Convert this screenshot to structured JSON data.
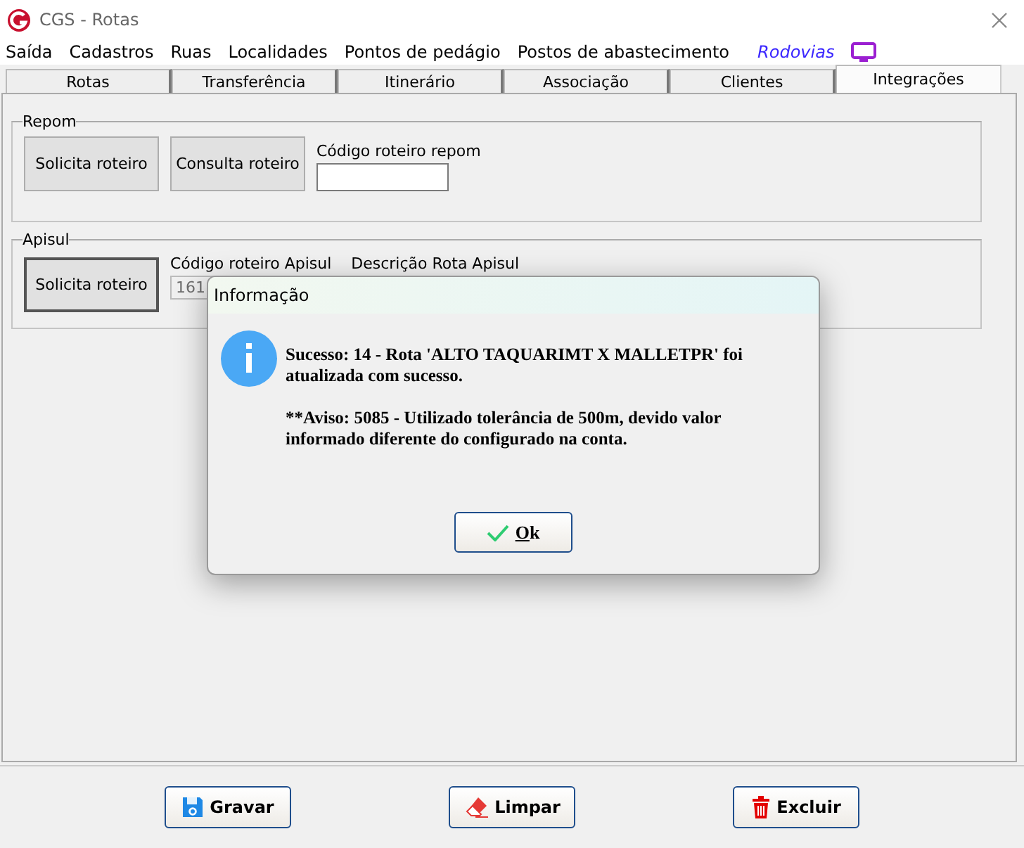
{
  "window": {
    "title": "CGS - Rotas"
  },
  "menu": [
    {
      "label": "Saída",
      "kind": "menu"
    },
    {
      "label": "Cadastros",
      "kind": "menu"
    },
    {
      "label": "Ruas",
      "kind": "menu"
    },
    {
      "label": "Localidades",
      "kind": "menu"
    },
    {
      "label": "Pontos de pedágio",
      "kind": "menu"
    },
    {
      "label": "Postos de abastecimento",
      "kind": "menu"
    },
    {
      "label": "Rodovias",
      "kind": "highlight"
    }
  ],
  "tabs": [
    {
      "label": "Rotas",
      "selected": false
    },
    {
      "label": "Transferência",
      "selected": false
    },
    {
      "label": "Itinerário",
      "selected": false
    },
    {
      "label": "Associação",
      "selected": false
    },
    {
      "label": "Clientes",
      "selected": false
    },
    {
      "label": "Integrações",
      "selected": true
    }
  ],
  "repom": {
    "title": "Repom",
    "buttons": [
      "Solicita roteiro",
      "Consulta roteiro"
    ],
    "field_label": "Código roteiro repom"
  },
  "apisul": {
    "title": "Apisul",
    "button": "Solicita roteiro",
    "code_label": "Código roteiro Apisul",
    "description_label": "Descrição Rota Apisul",
    "code_value": "161"
  },
  "dialog": {
    "title": "Informação",
    "message": "Sucesso: 14 - Rota 'ALTO TAQUARIMT X MALLETPR' foi atualizada com sucesso.",
    "warning": " **Aviso: 5085 - Utilizado tolerância de 500m, devido valor informado diferente do configurado na conta.",
    "button": "Ok"
  },
  "actions": [
    {
      "label": "Gravar",
      "kind": "save"
    },
    {
      "label": "Limpar",
      "kind": "clear"
    },
    {
      "label": "Excluir",
      "kind": "delete"
    }
  ]
}
